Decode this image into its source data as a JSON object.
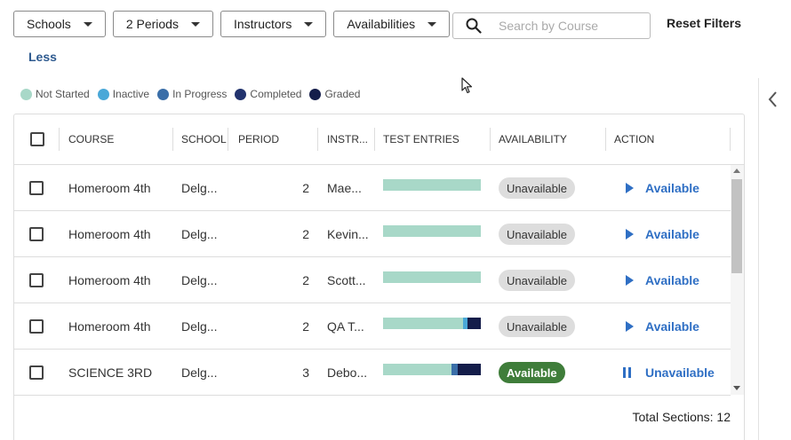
{
  "filters": {
    "schools": "Schools",
    "periods": "2 Periods",
    "instructors": "Instructors",
    "availabilities": "Availabilities",
    "search_placeholder": "Search by Course",
    "search_value": "",
    "reset": "Reset Filters",
    "less": "Less"
  },
  "legend": [
    {
      "label": "Not Started",
      "color": "#a8d8c8"
    },
    {
      "label": "Inactive",
      "color": "#4aa8d8"
    },
    {
      "label": "In Progress",
      "color": "#3a6ea8"
    },
    {
      "label": "Completed",
      "color": "#22336e"
    },
    {
      "label": "Graded",
      "color": "#141d4a"
    }
  ],
  "table": {
    "headers": {
      "course": "COURSE",
      "school": "SCHOOL",
      "period": "PERIOD",
      "instructor": "INSTR...",
      "test_entries": "TEST ENTRIES",
      "availability": "AVAILABILITY",
      "action": "ACTION"
    },
    "rows": [
      {
        "course": "Homeroom 4th",
        "school": "Delg...",
        "period": "2",
        "instructor": "Mae...",
        "availability": "Unavailable",
        "action": "Available",
        "entries": {
          "not_started": 1.0,
          "inactive": 0,
          "in_progress": 0,
          "completed": 0,
          "graded": 0
        }
      },
      {
        "course": "Homeroom 4th",
        "school": "Delg...",
        "period": "2",
        "instructor": "Kevin...",
        "availability": "Unavailable",
        "action": "Available",
        "entries": {
          "not_started": 1.0,
          "inactive": 0,
          "in_progress": 0,
          "completed": 0,
          "graded": 0
        }
      },
      {
        "course": "Homeroom 4th",
        "school": "Delg...",
        "period": "2",
        "instructor": "Scott...",
        "availability": "Unavailable",
        "action": "Available",
        "entries": {
          "not_started": 1.0,
          "inactive": 0,
          "in_progress": 0,
          "completed": 0,
          "graded": 0
        }
      },
      {
        "course": "Homeroom 4th",
        "school": "Delg...",
        "period": "2",
        "instructor": "QA T...",
        "availability": "Unavailable",
        "action": "Available",
        "entries": {
          "not_started": 0.82,
          "inactive": 0.04,
          "in_progress": 0,
          "completed": 0,
          "graded": 0.14
        }
      },
      {
        "course": "SCIENCE 3RD",
        "school": "Delg...",
        "period": "3",
        "instructor": "Debo...",
        "availability": "Available",
        "action": "Unavailable",
        "entries": {
          "not_started": 0.7,
          "inactive": 0,
          "in_progress": 0.06,
          "completed": 0,
          "graded": 0.24
        }
      }
    ]
  },
  "footer": {
    "total": "Total Sections: 12"
  }
}
